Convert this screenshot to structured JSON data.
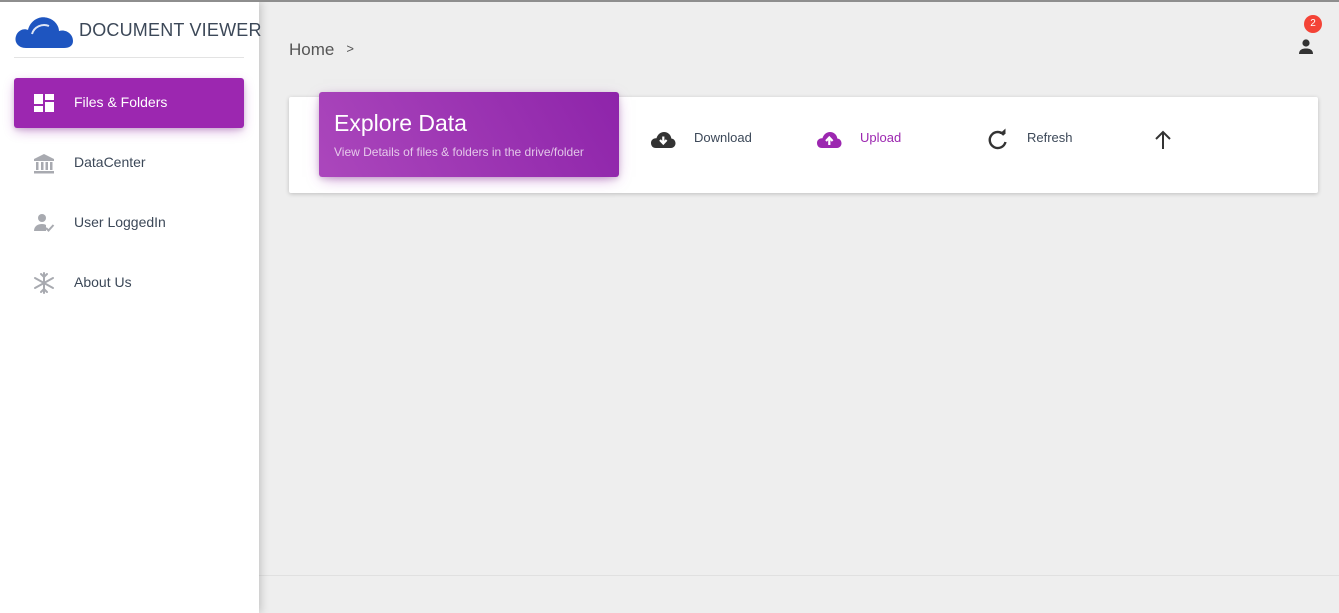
{
  "app": {
    "title": "DOCUMENT VIEWER",
    "logo_icon": "cloud-logo-icon",
    "brand_color": "#1e55c0"
  },
  "sidebar": {
    "items": [
      {
        "label": "Files & Folders",
        "icon": "dashboard-grid-icon",
        "active": true
      },
      {
        "label": "DataCenter",
        "icon": "bank-building-icon",
        "active": false
      },
      {
        "label": "User LoggedIn",
        "icon": "user-check-icon",
        "active": false
      },
      {
        "label": "About Us",
        "icon": "snowflake-icon",
        "active": false
      }
    ],
    "active_color": "#9c27b0"
  },
  "header": {
    "breadcrumb": {
      "home": "Home",
      "separator": ">"
    },
    "notifications_count": "2",
    "account_icon": "person-icon"
  },
  "card": {
    "title": "Explore Data",
    "subtitle": "View Details of files & folders in the drive/folder",
    "actions": [
      {
        "label": "Download",
        "icon": "cloud-download-icon",
        "color": "#333333"
      },
      {
        "label": "Upload",
        "icon": "cloud-upload-icon",
        "color": "#9c27b0"
      },
      {
        "label": "Refresh",
        "icon": "refresh-icon",
        "color": "#333333"
      },
      {
        "label": "",
        "icon": "arrow-up-icon",
        "color": "#333333"
      }
    ]
  }
}
